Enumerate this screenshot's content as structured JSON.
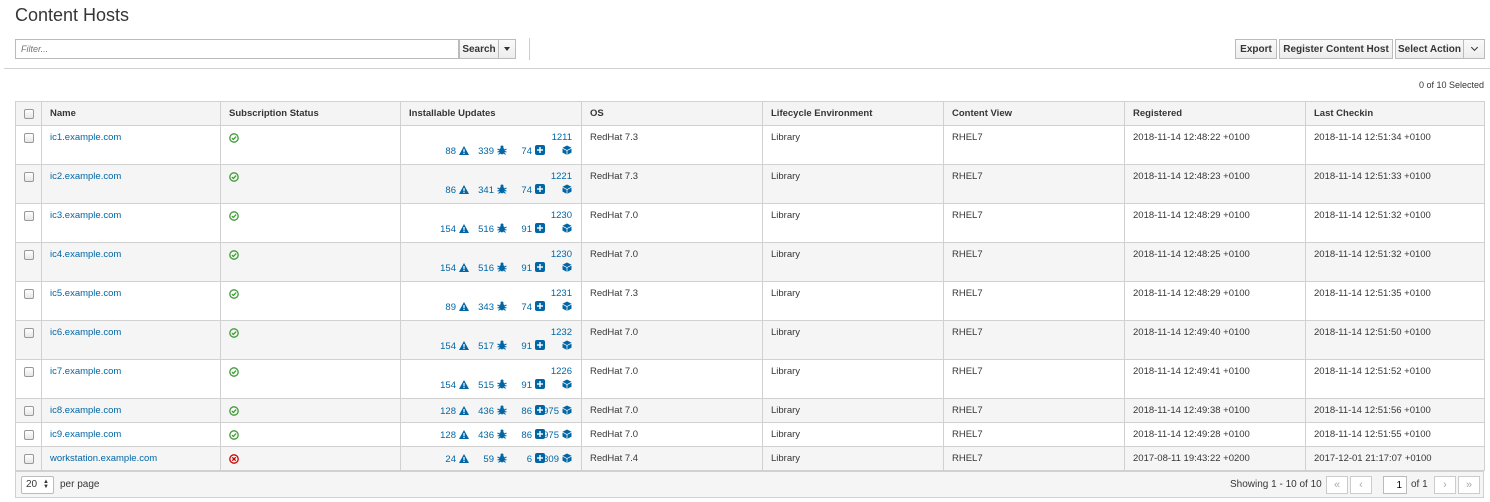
{
  "page": {
    "title": "Content Hosts"
  },
  "search": {
    "placeholder": "Filter...",
    "button_label": "Search"
  },
  "toolbar": {
    "export_label": "Export",
    "register_label": "Register Content Host",
    "select_action_label": "Select Action"
  },
  "selection": {
    "text": "0 of 10 Selected"
  },
  "table": {
    "columns": [
      "Name",
      "Subscription Status",
      "Installable Updates",
      "OS",
      "Lifecycle Environment",
      "Content View",
      "Registered",
      "Last Checkin"
    ],
    "rows": [
      {
        "name": "ic1.example.com",
        "status": "ok",
        "security": "88",
        "bugfix": "339",
        "enhancement": "74",
        "packages": "1211",
        "os": "RedHat 7.3",
        "lifecycle": "Library",
        "content_view": "RHEL7",
        "registered": "2018-11-14 12:48:22 +0100",
        "last_checkin": "2018-11-14 12:51:34 +0100"
      },
      {
        "name": "ic2.example.com",
        "status": "ok",
        "security": "86",
        "bugfix": "341",
        "enhancement": "74",
        "packages": "1221",
        "os": "RedHat 7.3",
        "lifecycle": "Library",
        "content_view": "RHEL7",
        "registered": "2018-11-14 12:48:23 +0100",
        "last_checkin": "2018-11-14 12:51:33 +0100"
      },
      {
        "name": "ic3.example.com",
        "status": "ok",
        "security": "154",
        "bugfix": "516",
        "enhancement": "91",
        "packages": "1230",
        "os": "RedHat 7.0",
        "lifecycle": "Library",
        "content_view": "RHEL7",
        "registered": "2018-11-14 12:48:29 +0100",
        "last_checkin": "2018-11-14 12:51:32 +0100"
      },
      {
        "name": "ic4.example.com",
        "status": "ok",
        "security": "154",
        "bugfix": "516",
        "enhancement": "91",
        "packages": "1230",
        "os": "RedHat 7.0",
        "lifecycle": "Library",
        "content_view": "RHEL7",
        "registered": "2018-11-14 12:48:25 +0100",
        "last_checkin": "2018-11-14 12:51:32 +0100"
      },
      {
        "name": "ic5.example.com",
        "status": "ok",
        "security": "89",
        "bugfix": "343",
        "enhancement": "74",
        "packages": "1231",
        "os": "RedHat 7.3",
        "lifecycle": "Library",
        "content_view": "RHEL7",
        "registered": "2018-11-14 12:48:29 +0100",
        "last_checkin": "2018-11-14 12:51:35 +0100"
      },
      {
        "name": "ic6.example.com",
        "status": "ok",
        "security": "154",
        "bugfix": "517",
        "enhancement": "91",
        "packages": "1232",
        "os": "RedHat 7.0",
        "lifecycle": "Library",
        "content_view": "RHEL7",
        "registered": "2018-11-14 12:49:40 +0100",
        "last_checkin": "2018-11-14 12:51:50 +0100"
      },
      {
        "name": "ic7.example.com",
        "status": "ok",
        "security": "154",
        "bugfix": "515",
        "enhancement": "91",
        "packages": "1226",
        "os": "RedHat 7.0",
        "lifecycle": "Library",
        "content_view": "RHEL7",
        "registered": "2018-11-14 12:49:41 +0100",
        "last_checkin": "2018-11-14 12:51:52 +0100"
      },
      {
        "name": "ic8.example.com",
        "status": "ok",
        "security": "128",
        "bugfix": "436",
        "enhancement": "86",
        "packages": "975",
        "os": "RedHat 7.0",
        "lifecycle": "Library",
        "content_view": "RHEL7",
        "registered": "2018-11-14 12:49:38 +0100",
        "last_checkin": "2018-11-14 12:51:56 +0100"
      },
      {
        "name": "ic9.example.com",
        "status": "ok",
        "security": "128",
        "bugfix": "436",
        "enhancement": "86",
        "packages": "975",
        "os": "RedHat 7.0",
        "lifecycle": "Library",
        "content_view": "RHEL7",
        "registered": "2018-11-14 12:49:28 +0100",
        "last_checkin": "2018-11-14 12:51:55 +0100"
      },
      {
        "name": "workstation.example.com",
        "status": "error",
        "security": "24",
        "bugfix": "59",
        "enhancement": "6",
        "packages": "309",
        "os": "RedHat 7.4",
        "lifecycle": "Library",
        "content_view": "RHEL7",
        "registered": "2017-08-11 19:43:22 +0200",
        "last_checkin": "2017-12-01 21:17:07 +0100"
      }
    ]
  },
  "pagination": {
    "per_page": "20",
    "per_page_label": "per page",
    "showing": "Showing 1 - 10 of 10",
    "current_page": "1",
    "of_label": "of 1"
  },
  "colors": {
    "link": "#0066a6",
    "ok": "#3f9c35",
    "error": "#cc0000",
    "header_bg": "#f4f4f4",
    "stripe_bg": "#f5f5f5"
  },
  "icons": {
    "security": "warning-triangle-icon",
    "bugfix": "bug-icon",
    "enhancement": "plus-square-icon",
    "packages": "package-cube-icon",
    "ok": "check-circle-icon",
    "error": "error-circle-icon"
  }
}
